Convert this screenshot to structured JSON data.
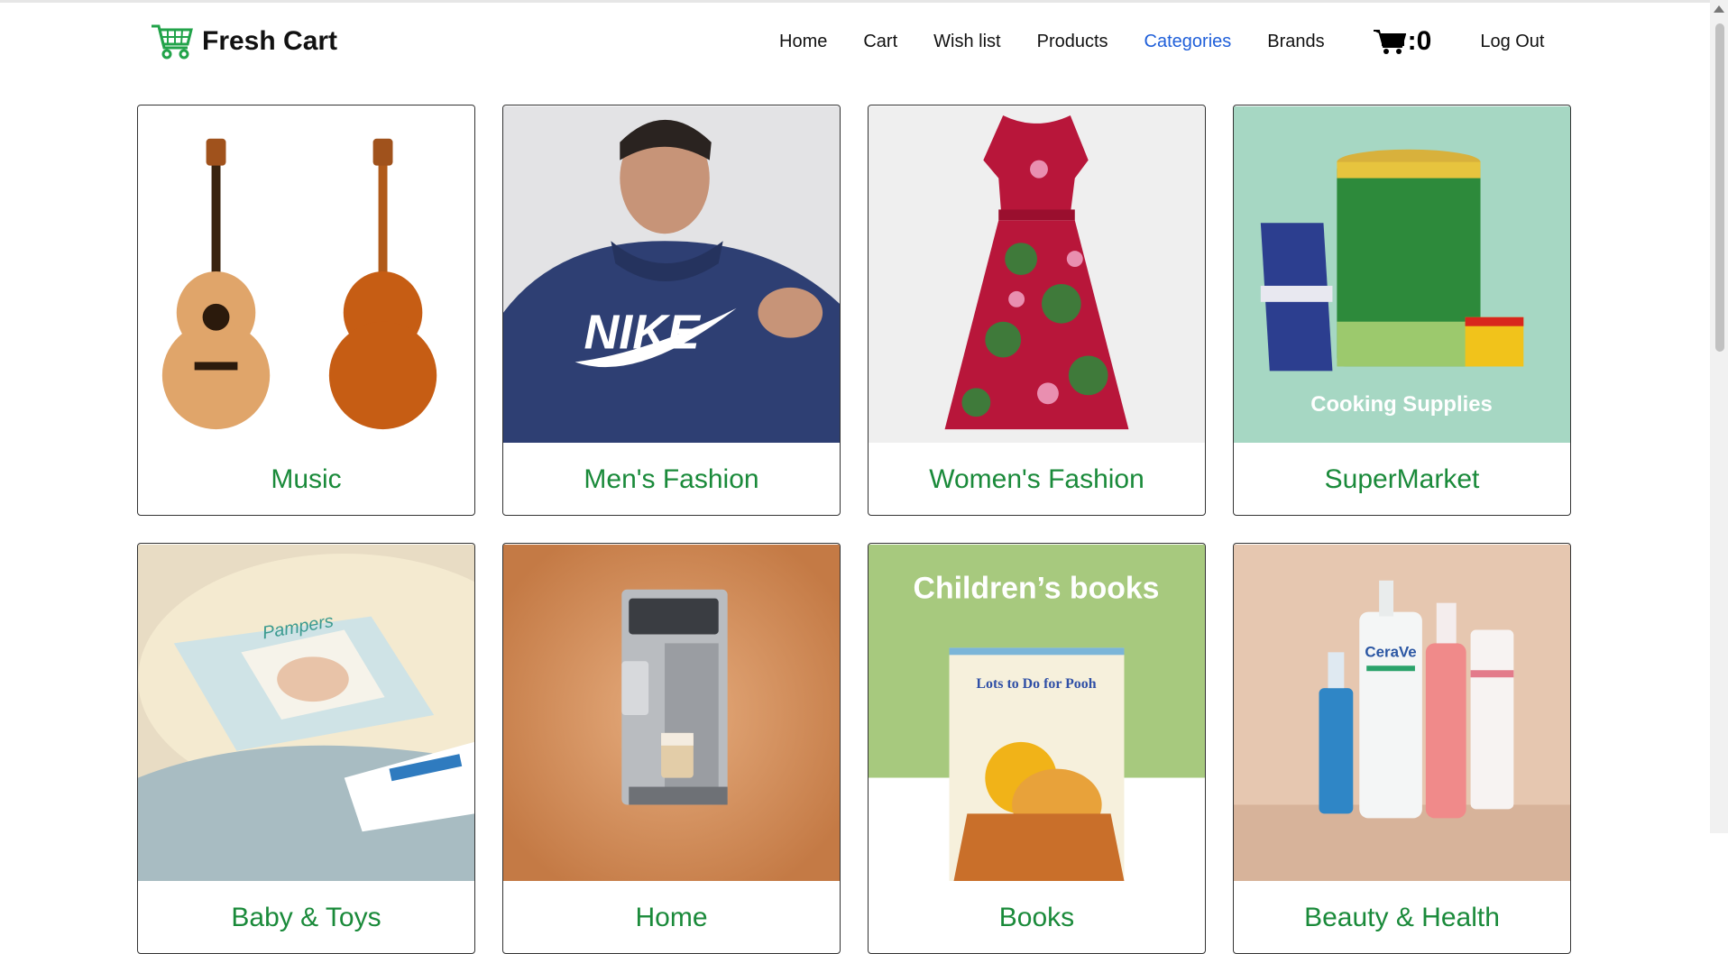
{
  "navbar": {
    "brand": "Fresh Cart",
    "links": [
      "Home",
      "Cart",
      "Wish list",
      "Products",
      "Categories",
      "Brands"
    ],
    "active_link": "Categories",
    "cart_count": ":0",
    "logout": "Log Out"
  },
  "categories": [
    {
      "name": "Music",
      "image_text": ""
    },
    {
      "name": "Men's Fashion",
      "image_text": "NIKE"
    },
    {
      "name": "Women's Fashion",
      "image_text": ""
    },
    {
      "name": "SuperMarket",
      "image_text": "Cooking Supplies"
    },
    {
      "name": "Baby & Toys",
      "image_text": "Pampers"
    },
    {
      "name": "Home",
      "image_text": ""
    },
    {
      "name": "Books",
      "image_text": "Children’s books",
      "book_title": "Lots to Do for Pooh"
    },
    {
      "name": "Beauty & Health",
      "image_text": "CeraVe"
    }
  ],
  "colors": {
    "accent_green": "#1a8a3a",
    "active_link": "#1f5fd9"
  }
}
